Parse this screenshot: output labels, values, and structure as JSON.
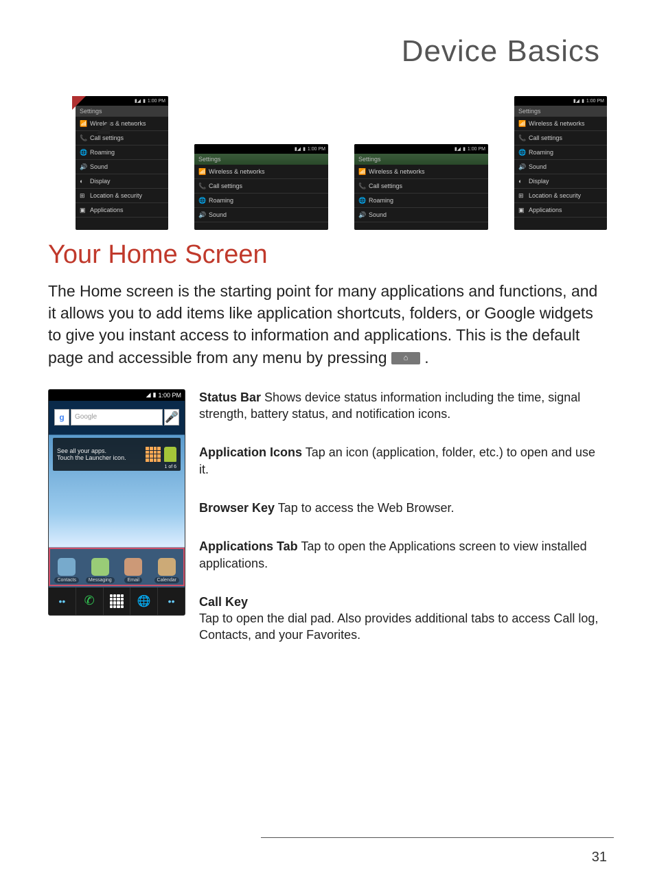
{
  "header": "Device Basics",
  "section_title": "Your Home Screen",
  "intro_text": "The Home screen is the starting point for many applications and functions, and it allows you to add items like application shortcuts, folders, or Google widgets to give you instant access to information and applications. This is the default page and accessible from any menu by pressing ",
  "intro_period": ".",
  "screens": {
    "status_time": "1:00 PM",
    "header_label": "Settings",
    "items": [
      "Wireless & networks",
      "Call settings",
      "Roaming",
      "Sound",
      "Display",
      "Location & security",
      "Applications"
    ],
    "short_items": [
      "Wireless & networks",
      "Call settings",
      "Roaming",
      "Sound"
    ]
  },
  "home_phone": {
    "status_time": "1:00 PM",
    "search_placeholder": "Google",
    "tip_line1": "See all your apps.",
    "tip_line2": "Touch the Launcher icon.",
    "tip_page": "1 of 6",
    "dock": [
      "Contacts",
      "Messaging",
      "Email",
      "Calendar"
    ]
  },
  "callouts": {
    "status_bar": {
      "label": "Status Bar",
      "text": " Shows device status information including the time, signal strength, battery status, and notification icons."
    },
    "app_icons": {
      "label": "Application Icons",
      "text": " Tap an icon (application, folder, etc.) to open and use it."
    },
    "browser": {
      "label": "Browser Key",
      "text": " Tap to access the Web Browser."
    },
    "apps_tab": {
      "label": "Applications Tab",
      "text": " Tap to open the Applications screen to view installed applications."
    },
    "call_key": {
      "label": "Call Key",
      "text": "Tap to open the dial pad. Also provides additional tabs to access Call log, Contacts, and your Favorites."
    }
  },
  "page_number": "31"
}
